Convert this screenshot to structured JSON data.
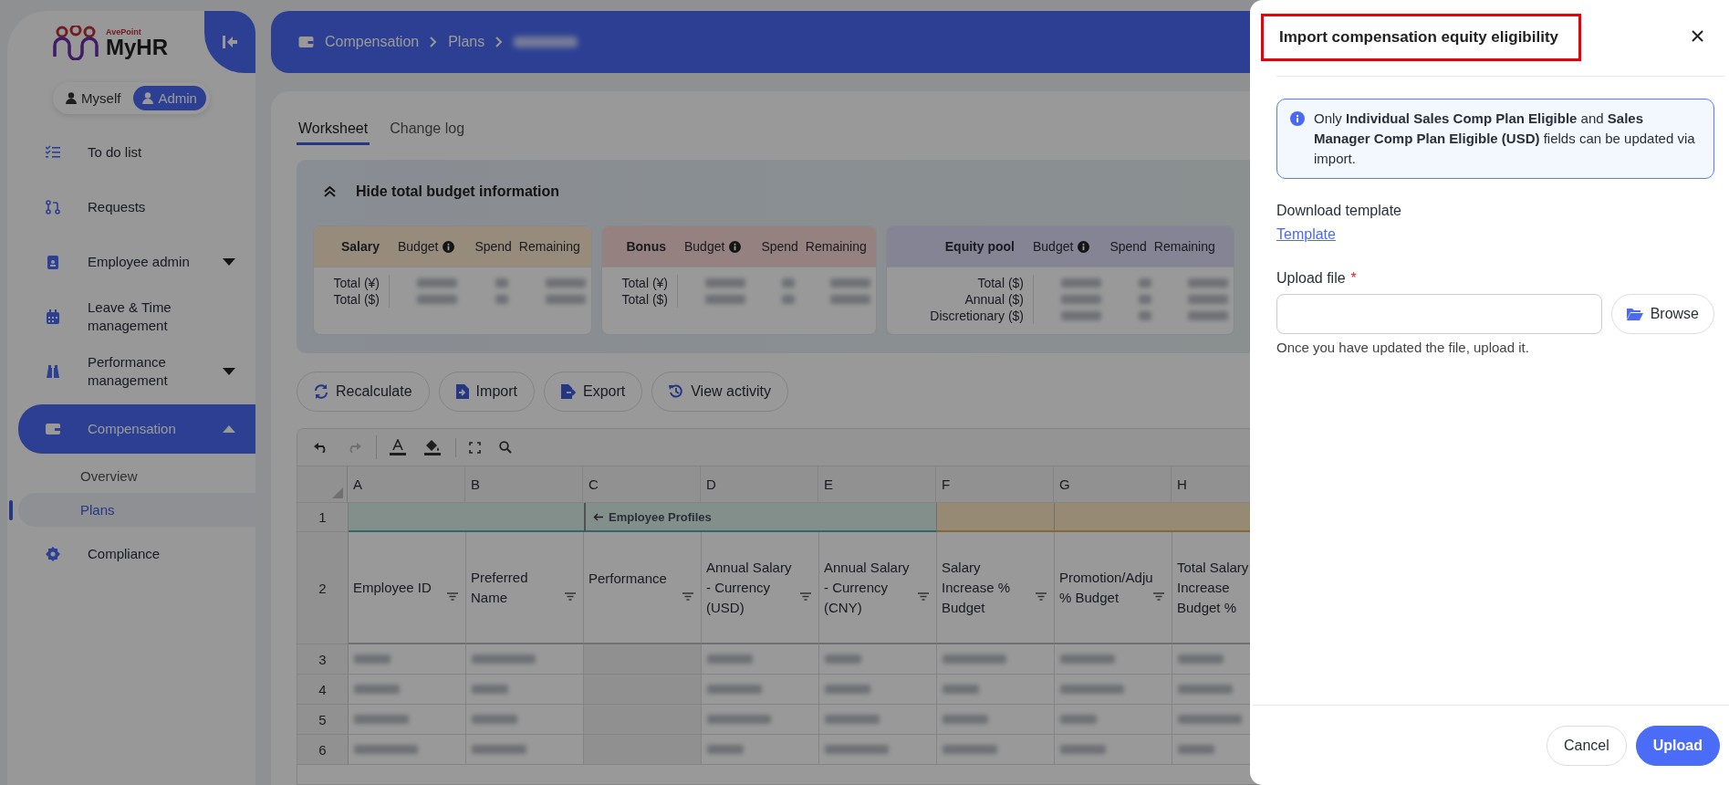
{
  "sidebar": {
    "logo": {
      "vendor": "AvePoint",
      "product": "MyHR"
    },
    "roles": [
      {
        "label": "Myself",
        "selected": false
      },
      {
        "label": "Admin",
        "selected": true
      }
    ],
    "items": [
      {
        "label": "To do list",
        "selected": false
      },
      {
        "label": "Requests",
        "selected": false
      },
      {
        "label": "Employee admin",
        "selected": false,
        "expanded": false
      },
      {
        "label": "Leave & Time management",
        "selected": false
      },
      {
        "label": "Performance management",
        "selected": false,
        "expanded": false
      },
      {
        "label": "Compensation",
        "selected": true,
        "expanded": true,
        "children": [
          {
            "label": "Overview",
            "selected": false
          },
          {
            "label": "Plans",
            "selected": true
          }
        ]
      },
      {
        "label": "Compliance",
        "selected": false
      }
    ]
  },
  "breadcrumb": [
    "Compensation",
    "Plans"
  ],
  "tabs": [
    {
      "label": "Worksheet",
      "selected": true
    },
    {
      "label": "Change log",
      "selected": false
    }
  ],
  "budget": {
    "toggle": "Hide total budget information",
    "cards": [
      {
        "title": "Salary",
        "color": "#978b7c",
        "headers": [
          "Budget",
          "Spend",
          "Remaining"
        ],
        "rows": [
          "Total (¥)",
          "Total ($)"
        ]
      },
      {
        "title": "Bonus",
        "color": "#958280",
        "headers": [
          "Budget",
          "Spend",
          "Remaining"
        ],
        "rows": [
          "Total (¥)",
          "Total ($)"
        ]
      },
      {
        "title": "Equity pool",
        "color": "#848494",
        "headers": [
          "Budget",
          "Spend",
          "Remaining"
        ],
        "rows": [
          "Total ($)",
          "Annual ($)",
          "Discretionary ($)"
        ]
      }
    ]
  },
  "actions": [
    "Recalculate",
    "Import",
    "Export",
    "View activity"
  ],
  "grid_tools": [
    {
      "kind": "undo",
      "disabled": false
    },
    {
      "kind": "redo",
      "disabled": true
    },
    {
      "kind": "text-color",
      "disabled": false
    },
    {
      "kind": "fill-color",
      "disabled": false
    },
    {
      "kind": "fullscreen",
      "disabled": false
    },
    {
      "kind": "search",
      "disabled": false
    }
  ],
  "grid": {
    "columns": [
      {
        "letter": "A",
        "color": "#828f8b"
      },
      {
        "letter": "B",
        "color": "#828f8b"
      },
      {
        "letter": "C",
        "color": "#828f8b",
        "group_label": "Employee Profiles"
      },
      {
        "letter": "D",
        "color": "#828f8b"
      },
      {
        "letter": "E",
        "color": "#828f8b"
      },
      {
        "letter": "F",
        "color": "#978a74"
      },
      {
        "letter": "G",
        "color": "#978a74"
      },
      {
        "letter": "H",
        "color": "#978a74"
      }
    ],
    "row_numbers": [
      "1",
      "2",
      "3",
      "4",
      "5",
      "6"
    ],
    "headers": [
      "Employee ID",
      "Preferred Name",
      "Performance",
      "Annual Salary - Currency (USD)",
      "Annual Salary - Currency (CNY)",
      "Salary Increase % Budget",
      "Promotion/Adju % Budget",
      "Total Salary Increase Budget %"
    ]
  },
  "drawer": {
    "title": "Import compensation equity eligibility",
    "title_highlighted": true,
    "info": "Only **Individual Sales Comp Plan Eligible** and **Sales Manager Comp Plan Eligible (USD)** fields can be updated via import.",
    "download_label": "Download template",
    "template_link": "Template",
    "upload_label": "Upload file",
    "required_mark": "*",
    "browse": "Browse",
    "hint": "Once you have updated the file, upload it.",
    "buttons": [
      "Cancel",
      "Upload"
    ]
  }
}
